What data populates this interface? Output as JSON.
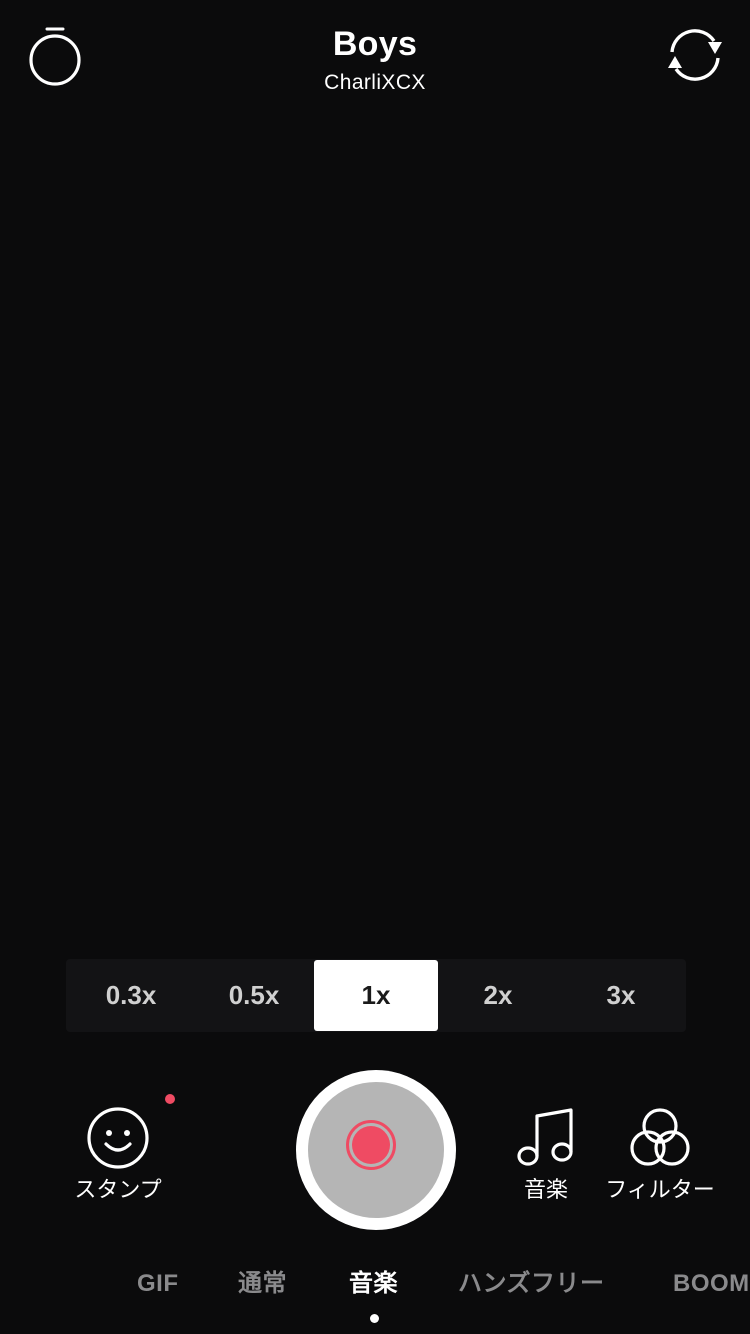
{
  "top_bar": {
    "timer_icon": "stopwatch-icon",
    "song_title": "Boys",
    "song_artist": "CharliXCX",
    "flip_icon": "camera-flip-icon"
  },
  "zoom": {
    "options": [
      "0.3x",
      "0.5x",
      "1x",
      "2x",
      "3x"
    ],
    "selected": "1x"
  },
  "controls": {
    "stamp": {
      "label": "スタンプ",
      "icon": "smiley-icon",
      "has_notification": true
    },
    "shutter": {
      "icon": "record-icon"
    },
    "music": {
      "label": "音楽",
      "icon": "music-note-icon"
    },
    "filter": {
      "label": "フィルター",
      "icon": "filter-circles-icon"
    }
  },
  "modes": {
    "items": [
      "GIF",
      "通常",
      "音楽",
      "ハンズフリー",
      "BOOM"
    ],
    "selected": "音楽"
  },
  "colors": {
    "background": "#0b0b0c",
    "accent": "#ef4b63",
    "inactive_text": "#8a8a8c",
    "shutter_fill": "#b5b5b5"
  }
}
